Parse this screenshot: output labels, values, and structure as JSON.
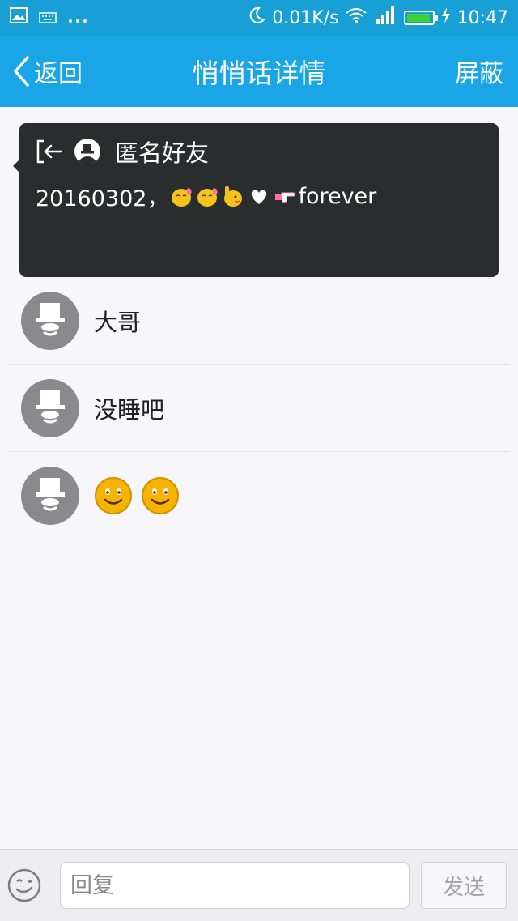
{
  "status_bar": {
    "speed": "0.01K/s",
    "time": "10:47",
    "icons": [
      "image-icon",
      "keyboard-icon",
      "more-dots-icon",
      "moon-icon",
      "wifi-icon",
      "signal-icon",
      "battery-icon",
      "charging-icon"
    ],
    "battery_level": 0.95,
    "battery_color": "#3ad13a"
  },
  "nav": {
    "back_label": "返回",
    "title": "悄悄话详情",
    "block_label": "屏蔽",
    "bg_color": "#1aa6e6"
  },
  "whisper": {
    "sender": "匿名好友",
    "text": "20160302，",
    "emoji_icons": [
      "blush-chick-emoji",
      "blush-chick-emoji",
      "thumbs-chick-emoji",
      "heart-emoji",
      "pointing-hand-emoji"
    ],
    "suffix": " forever",
    "bg_color": "#292d2d"
  },
  "replies": [
    {
      "text": "大哥"
    },
    {
      "text": "没睡吧"
    },
    {
      "text": "",
      "emoji_icons": [
        "smile-emoji",
        "smile-emoji"
      ]
    }
  ],
  "input_bar": {
    "placeholder": "回复",
    "send_label": "发送"
  }
}
